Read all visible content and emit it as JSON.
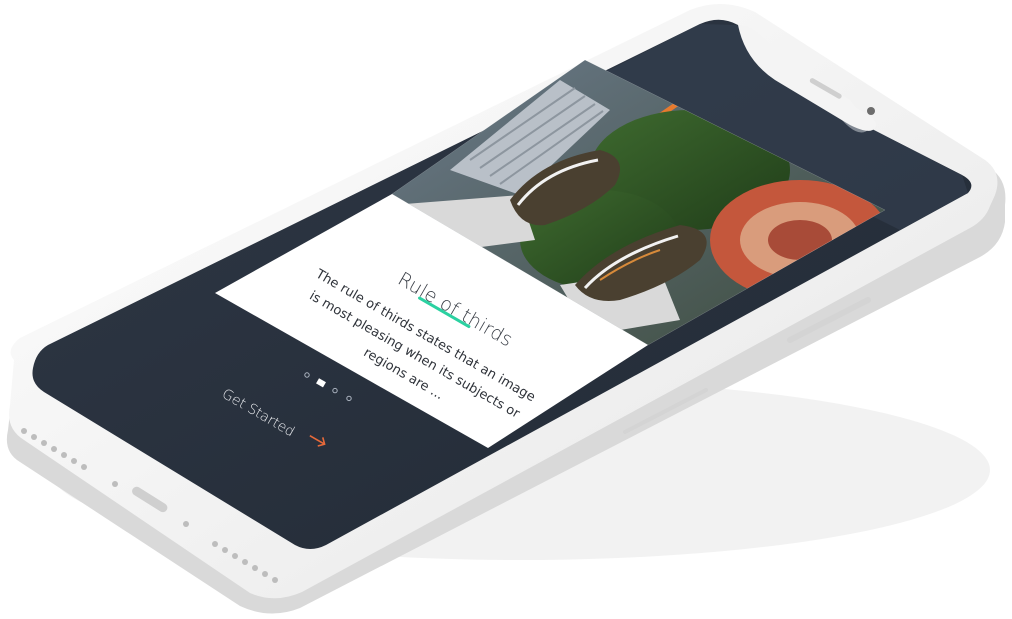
{
  "card": {
    "title": "Rule of thirds",
    "body": "The rule of thirds states that an image is most pleasing when its subjects or regions are ..."
  },
  "cta": {
    "label": "Get Started",
    "icon": "arrow-right-icon"
  },
  "pagination": {
    "total": 4,
    "active": 2
  },
  "colors": {
    "accent": "#2bd1a1",
    "arrow": "#e86a3a",
    "screen_bg": "#2c3543",
    "device": "#f2f2f2"
  }
}
